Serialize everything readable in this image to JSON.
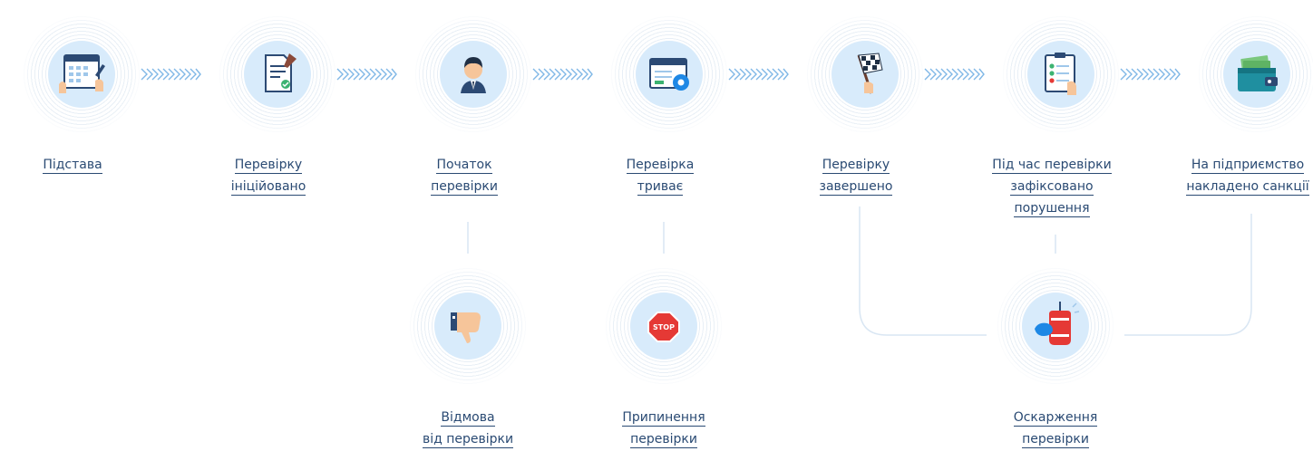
{
  "steps": [
    {
      "id": "basis",
      "lines": [
        "Підстава"
      ],
      "icon": "calendar-hands-icon"
    },
    {
      "id": "initiated",
      "lines": [
        "Перевірку",
        "ініційовано"
      ],
      "icon": "document-pen-icon"
    },
    {
      "id": "start",
      "lines": [
        "Початок",
        "перевірки"
      ],
      "icon": "inspector-person-icon"
    },
    {
      "id": "ongoing",
      "lines": [
        "Перевірка",
        "триває"
      ],
      "icon": "browser-gear-icon"
    },
    {
      "id": "finished",
      "lines": [
        "Перевірку",
        "завершено"
      ],
      "icon": "checkered-flag-icon"
    },
    {
      "id": "violations",
      "lines": [
        "Під час перевірки",
        "зафіксовано",
        "порушення"
      ],
      "icon": "clipboard-checklist-icon"
    },
    {
      "id": "sanctions",
      "lines": [
        "На підприємство",
        "накладено санкції"
      ],
      "icon": "wallet-money-icon"
    },
    {
      "id": "refusal",
      "lines": [
        "Відмова",
        "від перевірки"
      ],
      "icon": "thumbs-down-icon"
    },
    {
      "id": "termination",
      "lines": [
        "Припинення",
        "перевірки"
      ],
      "icon": "stop-sign-icon"
    },
    {
      "id": "appeal",
      "lines": [
        "Оскарження",
        "перевірки"
      ],
      "icon": "punching-bag-icon"
    }
  ],
  "colors": {
    "disc": "#d8ebfb",
    "label": "#2a4a73",
    "connector": "#d9e6f3",
    "chevron": "#7fb7e6",
    "stop": "#e53935"
  }
}
